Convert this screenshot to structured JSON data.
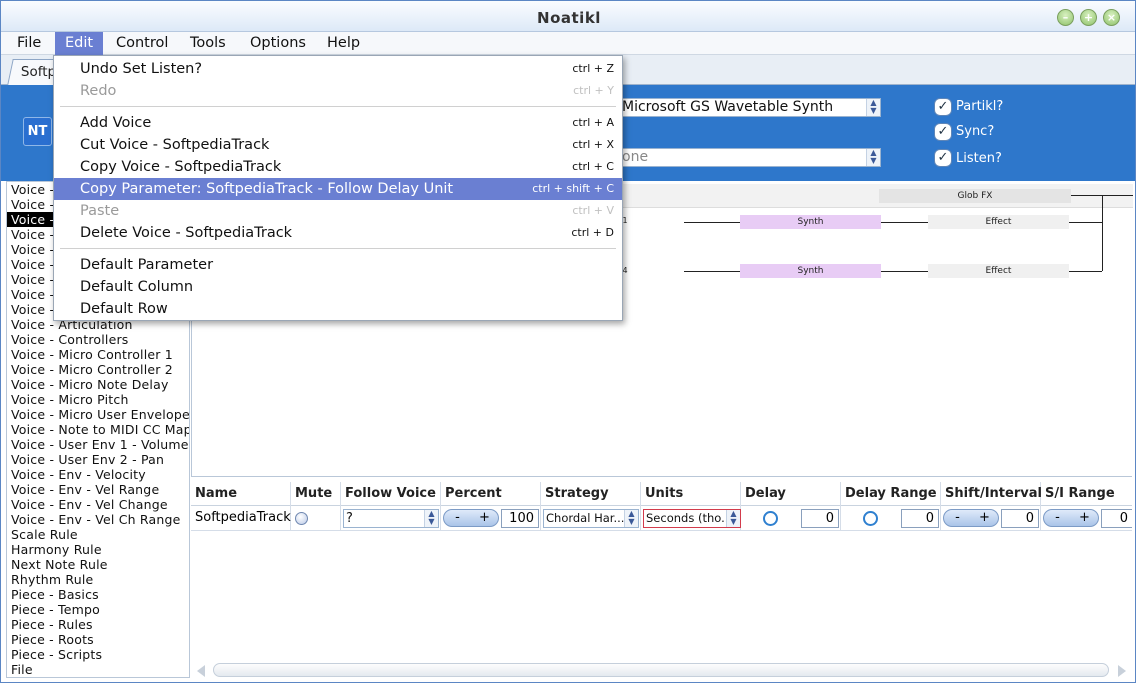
{
  "window": {
    "title": "Noatikl"
  },
  "menubar": [
    "File",
    "Edit",
    "Control",
    "Tools",
    "Options",
    "Help"
  ],
  "tab": {
    "label": "Softp"
  },
  "device": {
    "synth": "Microsoft GS Wavetable Synth",
    "second": "one"
  },
  "checks": [
    {
      "label": "Partikl?",
      "checked": true
    },
    {
      "label": "Sync?",
      "checked": true
    },
    {
      "label": "Listen?",
      "checked": true
    }
  ],
  "edit_menu": [
    {
      "label": "Undo Set Listen?",
      "shortcut": "ctrl + Z",
      "enabled": true
    },
    {
      "label": "Redo",
      "shortcut": "ctrl + Y",
      "enabled": false
    },
    {
      "label": "Add Voice",
      "shortcut": "ctrl + A",
      "enabled": true
    },
    {
      "label": "Cut Voice - SoftpediaTrack",
      "shortcut": "ctrl + X",
      "enabled": true
    },
    {
      "label": "Copy Voice - SoftpediaTrack",
      "shortcut": "ctrl + C",
      "enabled": true
    },
    {
      "label": "Copy Parameter: SoftpediaTrack - Follow Delay Unit",
      "shortcut": "ctrl + shift + C",
      "enabled": true
    },
    {
      "label": "Paste",
      "shortcut": "ctrl + V",
      "enabled": false
    },
    {
      "label": "Delete Voice - SoftpediaTrack",
      "shortcut": "ctrl + D",
      "enabled": true
    },
    {
      "label": "Default Parameter",
      "shortcut": "",
      "enabled": true
    },
    {
      "label": "Default Column",
      "shortcut": "",
      "enabled": true
    },
    {
      "label": "Default Row",
      "shortcut": "",
      "enabled": true
    }
  ],
  "left_list": [
    "Voice -",
    "Voice -",
    "Voice -",
    "Voice -",
    "Voice -",
    "Voice -",
    "Voice -",
    "Voice -",
    "Voice -",
    "Voice - Articulation",
    "Voice - Controllers",
    "Voice - Micro Controller 1",
    "Voice - Micro Controller 2",
    "Voice - Micro Note Delay",
    "Voice - Micro Pitch",
    "Voice - Micro User Envelope 1",
    "Voice - Note to MIDI CC Map",
    "Voice - User Env 1 - Volume",
    "Voice - User Env 2 - Pan",
    "Voice - Env - Velocity",
    "Voice - Env - Vel Range",
    "Voice - Env - Vel Change",
    "Voice - Env - Vel Ch Range",
    "Scale Rule",
    "Harmony Rule",
    "Next Note Rule",
    "Rhythm Rule",
    "Piece - Basics",
    "Piece - Tempo",
    "Piece - Rules",
    "Piece - Roots",
    "Piece - Scripts",
    "File"
  ],
  "graph": {
    "glob_fx": "Glob FX",
    "rows": [
      {
        "tag": "1",
        "synth": "Synth",
        "effect": "Effect"
      },
      {
        "tag": "4",
        "synth": "Synth",
        "effect": "Effect"
      }
    ]
  },
  "grid": {
    "columns": [
      "Name",
      "Mute",
      "Follow Voice",
      "Percent",
      "Strategy",
      "Units",
      "Delay",
      "Delay Range",
      "Shift/Interval",
      "S/I Range"
    ],
    "row": {
      "name": "SoftpediaTrack",
      "follow_voice": "?",
      "percent": "100",
      "strategy": "Chordal Har...",
      "units": "Seconds (tho...",
      "delay": "0",
      "delay_range": "0",
      "shift_interval": "0",
      "si_range": "0",
      "minus": "-",
      "plus": "+"
    }
  }
}
